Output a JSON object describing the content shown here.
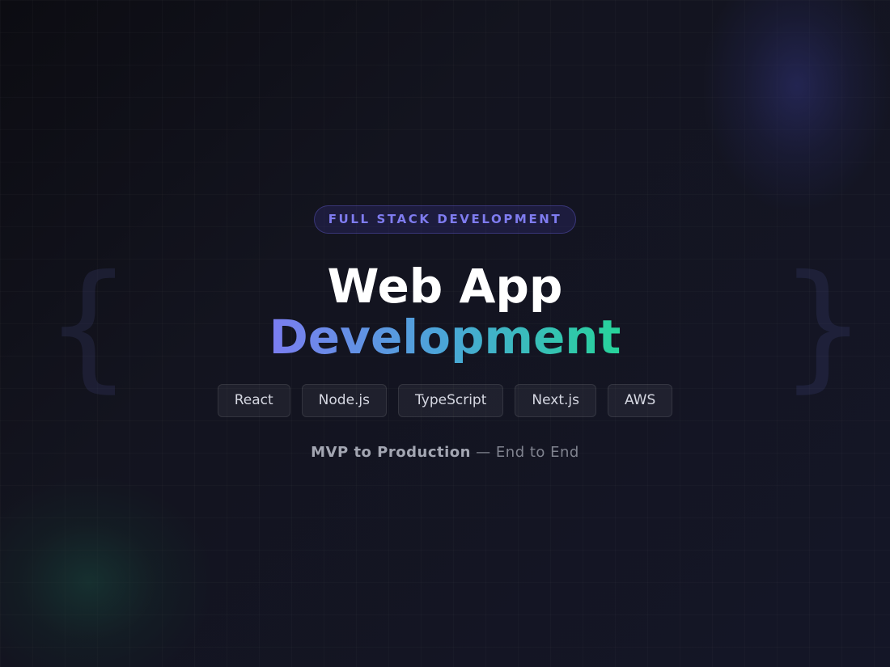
{
  "hero": {
    "badge": "FULL STACK DEVELOPMENT",
    "title_line1": "Web App",
    "title_line2": "Development",
    "braces": {
      "left": "{",
      "right": "}"
    },
    "tech_stack": [
      "React",
      "Node.js",
      "TypeScript",
      "Next.js",
      "AWS"
    ],
    "tagline": {
      "strong": "MVP to Production",
      "separator": " — ",
      "rest": "End to End"
    }
  },
  "colors": {
    "background": "#13141f",
    "accent_purple": "#7f7cf0",
    "gradient_start": "#7b7df0",
    "gradient_mid": "#4aa6d8",
    "gradient_end": "#27d49a",
    "chip_text": "#d6d8e2",
    "tagline_text": "#80838f"
  }
}
